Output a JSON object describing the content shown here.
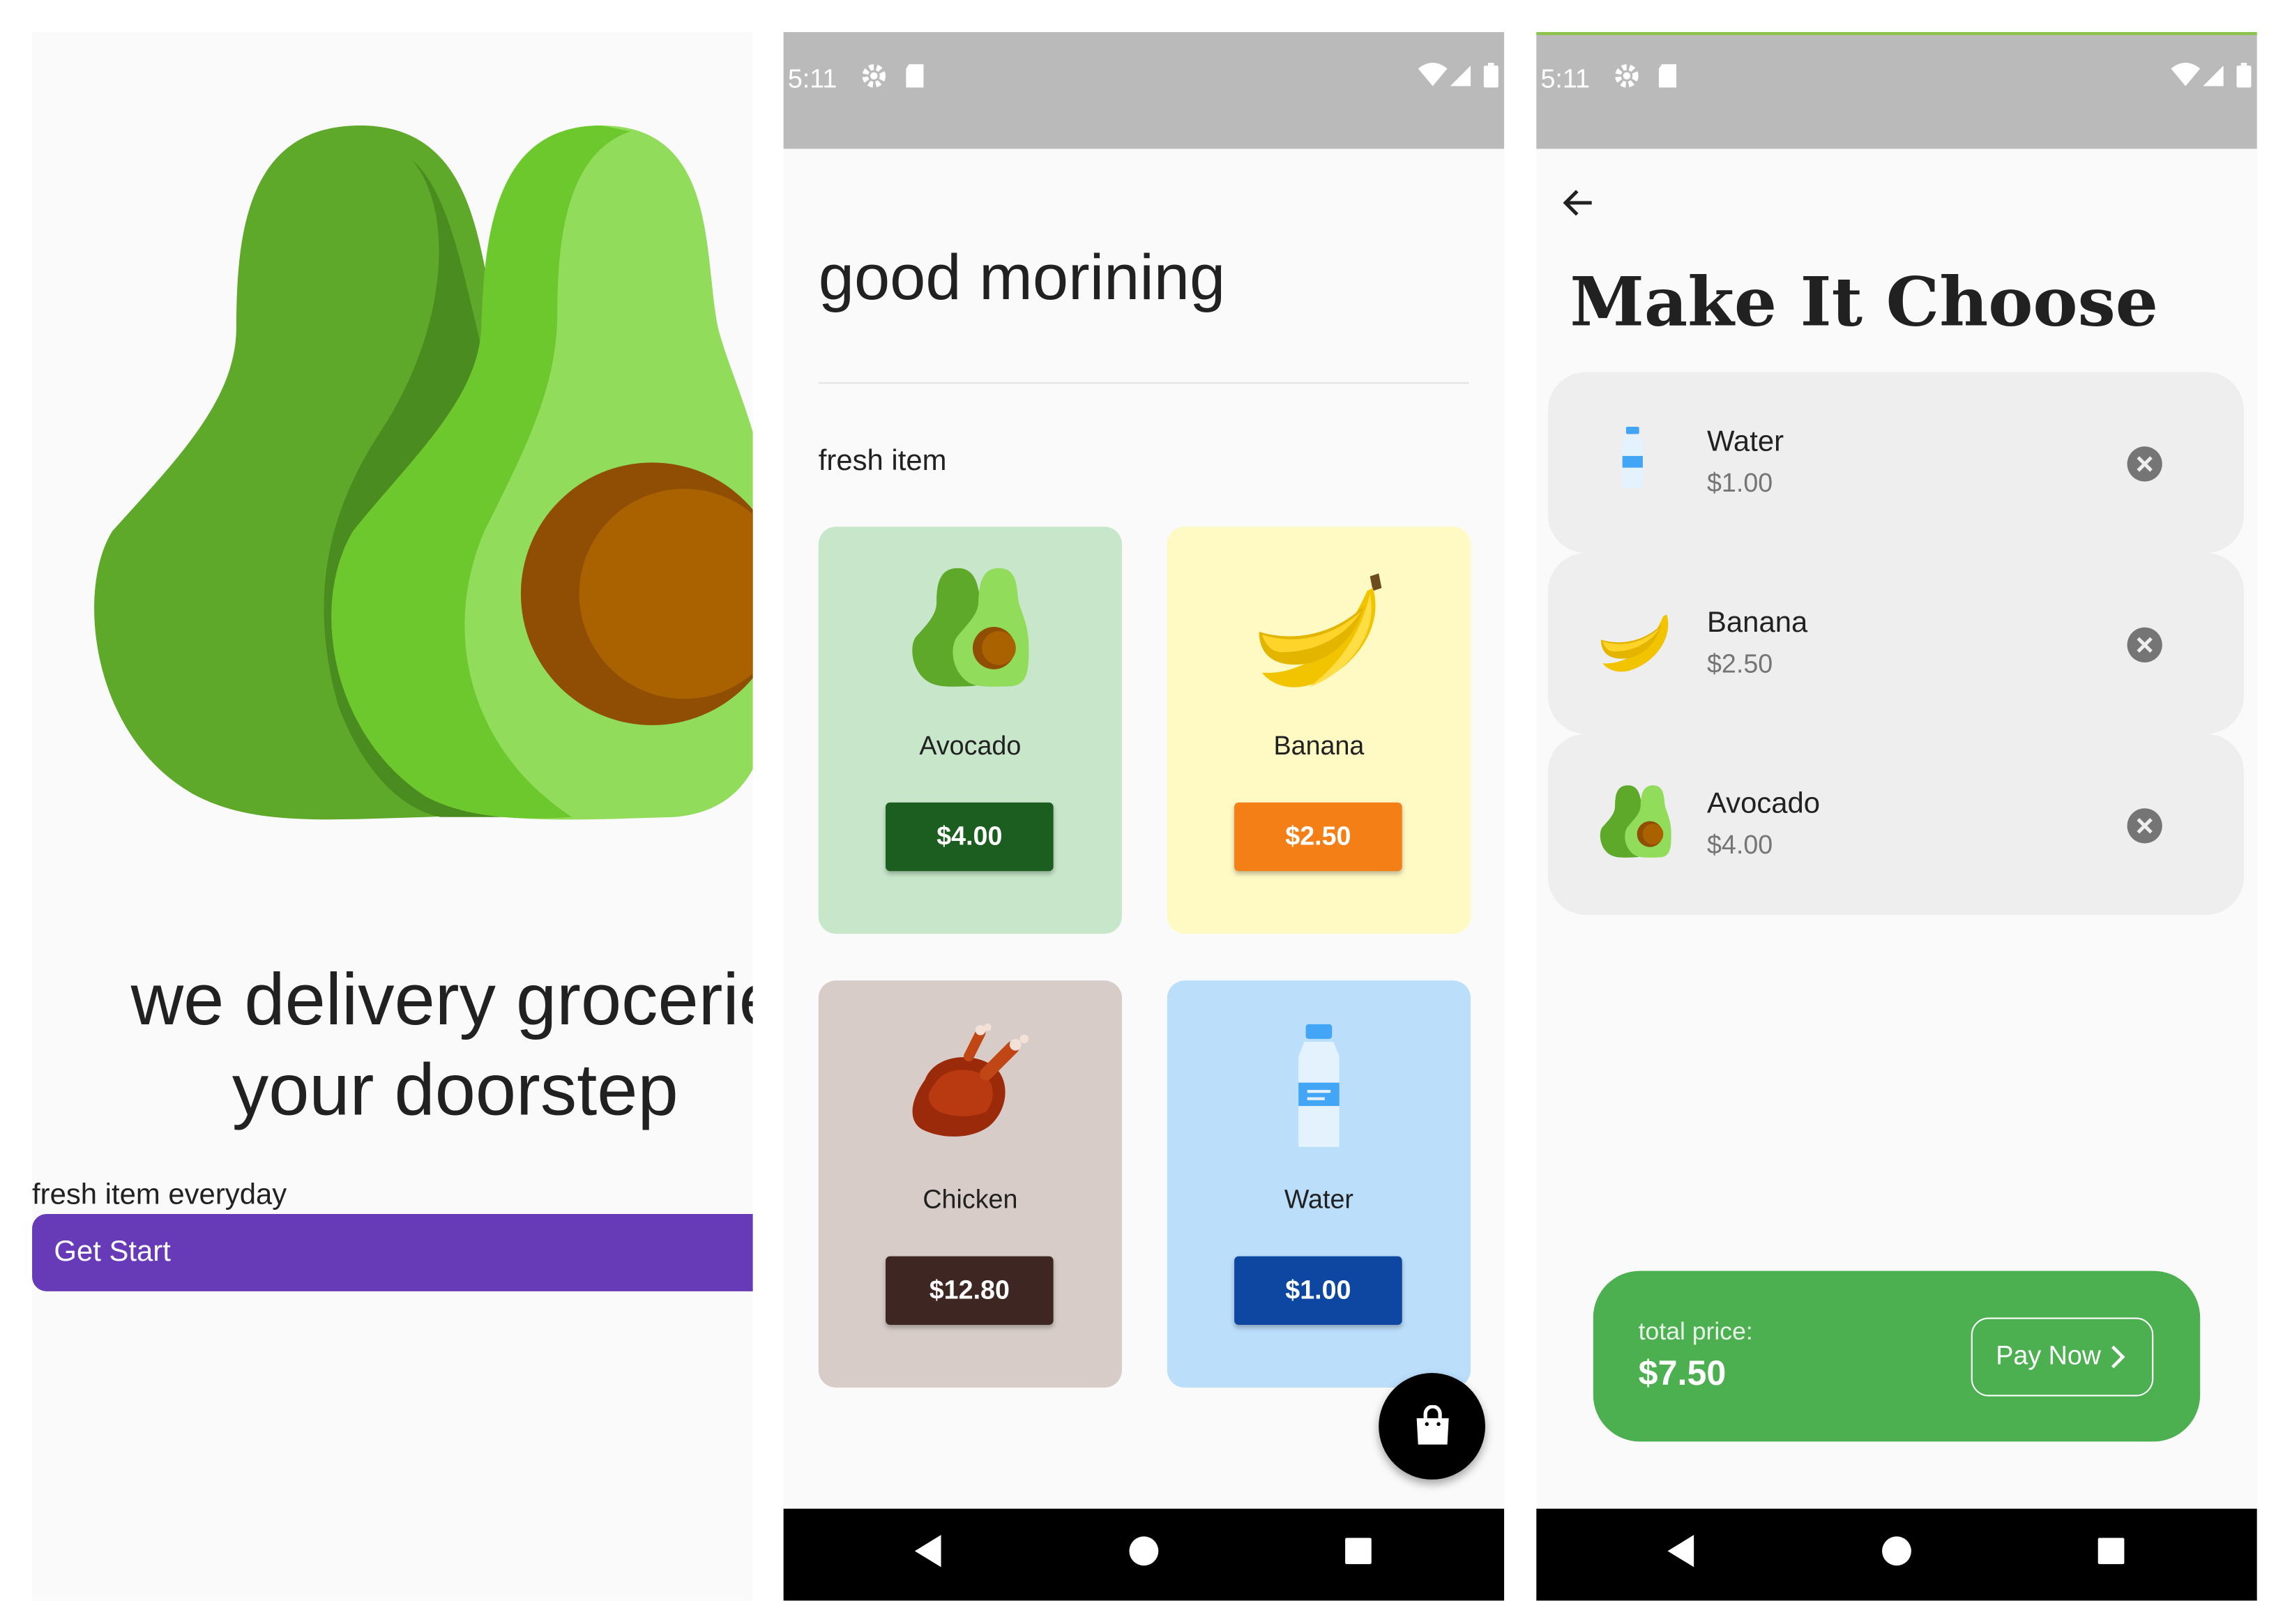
{
  "status": {
    "time": "5:11"
  },
  "welcome": {
    "headline_line1": "we delivery grocerie",
    "headline_line2": "your doorstep",
    "tagline": "fresh item everyday",
    "cta_label": "Get Start",
    "colors": {
      "cta": "#673ab7"
    }
  },
  "home": {
    "greeting": "good morining",
    "section_title": "fresh item",
    "products": [
      {
        "name": "Avocado",
        "price": "$4.00",
        "icon": "avocado-icon",
        "card_color": "#c8e6c9",
        "button_color": "#1b5e20"
      },
      {
        "name": "Banana",
        "price": "$2.50",
        "icon": "banana-icon",
        "card_color": "#fff9c4",
        "button_color": "#f57f17"
      },
      {
        "name": "Chicken",
        "price": "$12.80",
        "icon": "chicken-icon",
        "card_color": "#d7ccc8",
        "button_color": "#3e2723"
      },
      {
        "name": "Water",
        "price": "$1.00",
        "icon": "water-bottle-icon",
        "card_color": "#bbdefb",
        "button_color": "#0d47a1"
      }
    ],
    "fab_icon": "shopping-bag-icon"
  },
  "cart": {
    "title": "Make It Choose",
    "items": [
      {
        "name": "Water",
        "price": "$1.00",
        "icon": "water-bottle-icon"
      },
      {
        "name": "Banana",
        "price": "$2.50",
        "icon": "banana-icon"
      },
      {
        "name": "Avocado",
        "price": "$4.00",
        "icon": "avocado-icon"
      }
    ],
    "total_label": "total price:",
    "total_value": "$7.50",
    "pay_label": "Pay Now",
    "colors": {
      "total_panel": "#4caf50"
    }
  }
}
